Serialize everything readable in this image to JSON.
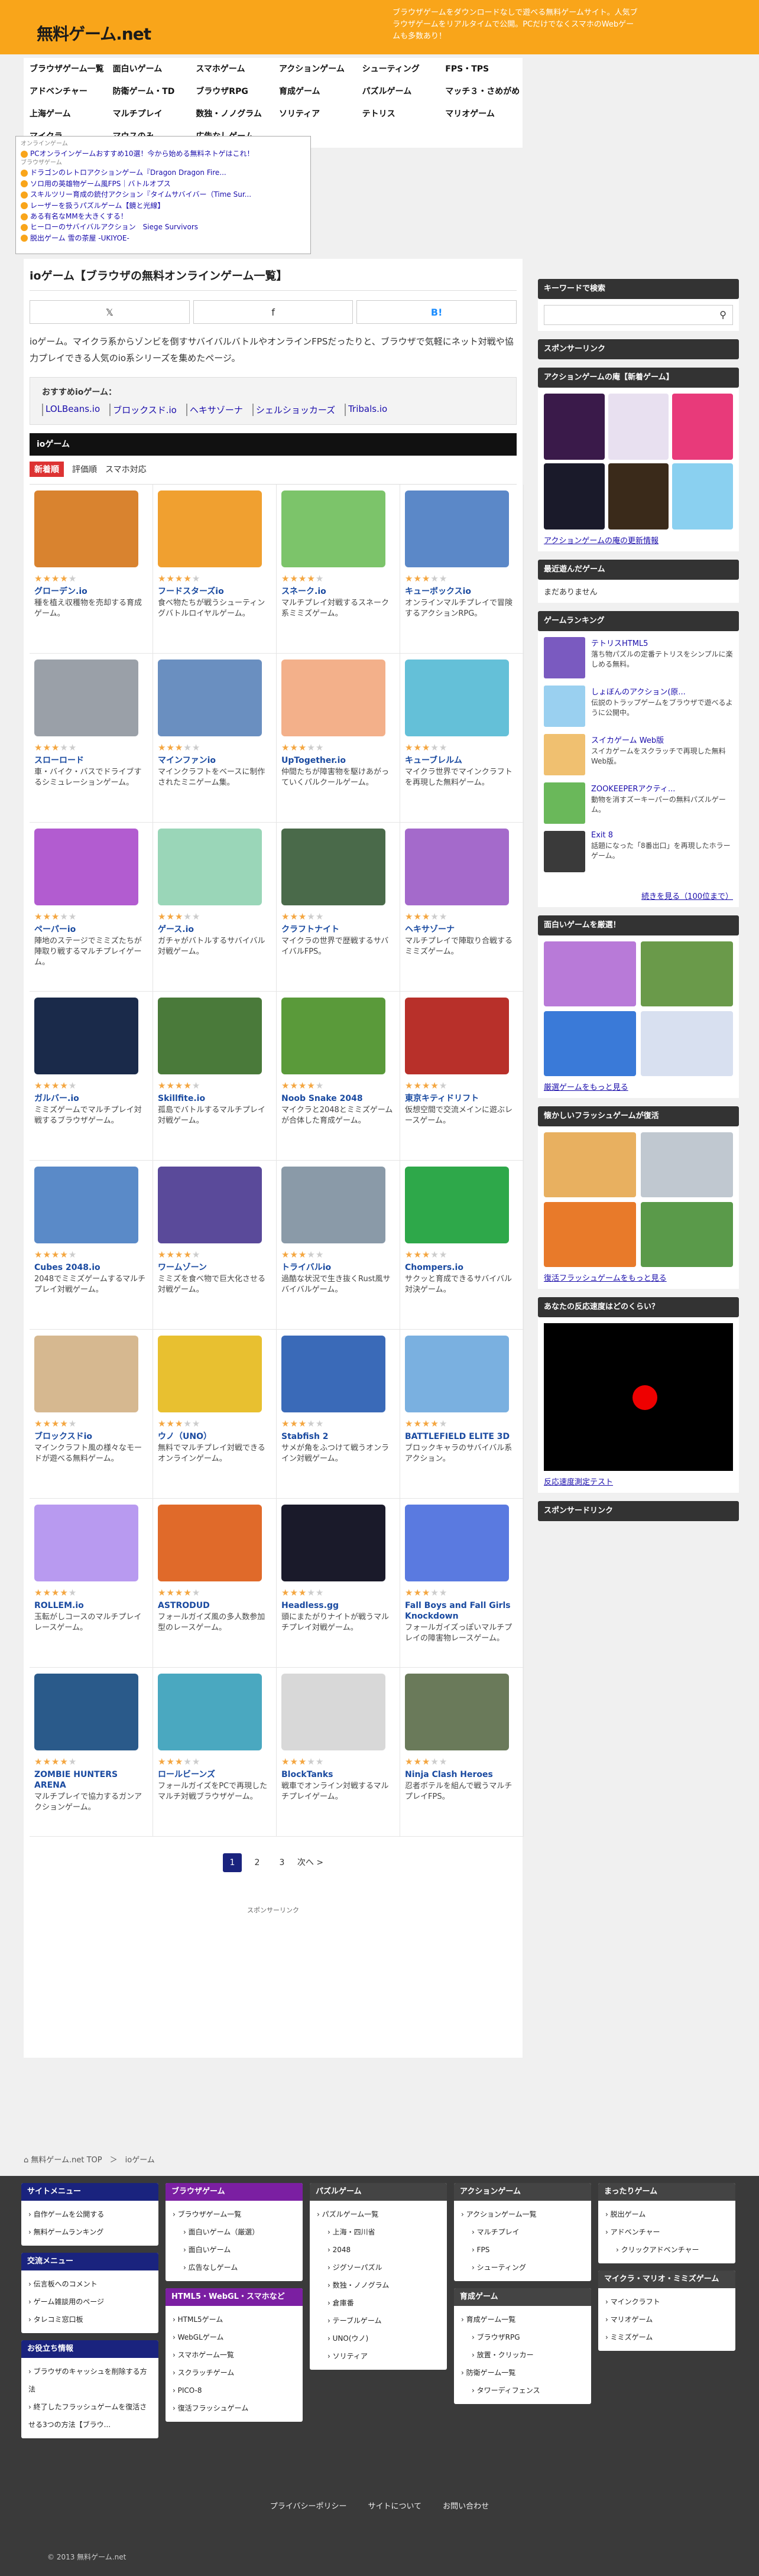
{
  "site": {
    "logo": "無料ゲーム.net",
    "tagline": "ブラウザゲームをダウンロードなしで遊べる無料ゲームサイト。人気ブラウザゲームをリアルタイムで公開。PCだけでなくスマホのWebゲームも多数あり！"
  },
  "nav": [
    "ブラウザゲーム一覧",
    "面白いゲーム",
    "スマホゲーム",
    "アクションゲーム",
    "シューティング",
    "FPS・TPS",
    "アドベンチャー",
    "防衛ゲーム・TD",
    "ブラウザRPG",
    "育成ゲーム",
    "パズルゲーム",
    "マッチ３・さめがめ",
    "上海ゲーム",
    "マルチプレイ",
    "数独・ノノグラム",
    "ソリティア",
    "テトリス",
    "マリオゲーム",
    "マイクラ",
    "マウスのみ",
    "広告なしゲーム"
  ],
  "news": {
    "header1": "オンラインゲーム",
    "header2": "ブラウザゲーム",
    "items": [
      "PCオンラインゲームおすすめ10選！今から始める無料ネトゲはこれ！",
      "ドラゴンのレトロアクションゲーム『Dragon Dragon Fire...",
      "ソロ用の英雄物ゲーム風FPS｜バトルオプス",
      "スキルツリー育成の銃付アクション『タイムサバイバー（Time Sur...",
      "レーザーを扱うパズルゲーム【鏡と光線】",
      "ある有名なMMを大きくする！",
      "ヒーローのサバイバルアクション　Siege Survivors",
      "脱出ゲーム 雪の茶屋 -UKIYOE-"
    ]
  },
  "main": {
    "title": "ioゲーム【ブラウザの無料オンラインゲーム一覧】",
    "share": [
      "𝕏",
      "f",
      "B!"
    ],
    "intro": "ioゲーム。マイクラ系からゾンビを倒すサバイバルバトルやオンラインFPSだったりと、ブラウザで気軽にネット対戦や協力プレイできる人気のio系シリーズを集めたページ。",
    "rec_label": "おすすめioゲーム：",
    "rec_links": [
      "LOLBeans.io",
      "ブロックスド.io",
      "ヘキサゾーナ",
      "シェルショッカーズ",
      "Tribals.io"
    ],
    "cat": "ioゲーム",
    "tabs": [
      "新着順",
      "評価順",
      "スマホ対応"
    ],
    "pages": [
      "1",
      "2",
      "3",
      "次へ >"
    ],
    "sponsor": "スポンサーリンク"
  },
  "games": [
    {
      "t": "グローデン.io",
      "d": "種を植え収穫物を売却する育成ゲーム。",
      "s": 4,
      "c": "#d9832f"
    },
    {
      "t": "フードスターズio",
      "d": "食べ物たちが戦うシューティングバトルロイヤルゲーム。",
      "s": 4,
      "c": "#f0a030"
    },
    {
      "t": "スネーク.io",
      "d": "マルチプレイ対戦するスネーク系ミミズゲーム。",
      "s": 4,
      "c": "#7cc46a"
    },
    {
      "t": "キューボックスio",
      "d": "オンラインマルチプレイで冒険するアクションRPG。",
      "s": 3,
      "c": "#5b88c8"
    },
    {
      "t": "スローロード",
      "d": "車・バイク・バスでドライブするシミュレーションゲーム。",
      "s": 3,
      "c": "#9aa0a8"
    },
    {
      "t": "マインファンio",
      "d": "マインクラフトをベースに制作されたミニゲーム集。",
      "s": 3,
      "c": "#6a8fc0"
    },
    {
      "t": "UpTogether.io",
      "d": "仲間たちが障害物を駆けあがっていくパルクールゲーム。",
      "s": 3,
      "c": "#f3b08a"
    },
    {
      "t": "キューブレルム",
      "d": "マイクラ世界でマインクラフトを再現した無料ゲーム。",
      "s": 3,
      "c": "#64c0d8"
    },
    {
      "t": "ペーパーio",
      "d": "陣地のステージでミミズたちが陣取り戦するマルチプレイゲーム。",
      "s": 3,
      "c": "#b25cd0"
    },
    {
      "t": "ゲース.io",
      "d": "ガチャがバトルするサバイバル対戦ゲーム。",
      "s": 3,
      "c": "#9ad6b8"
    },
    {
      "t": "クラフトナイト",
      "d": "マイクラの世界で歴戦するサバイバルFPS。",
      "s": 3,
      "c": "#4a6a4a"
    },
    {
      "t": "ヘキサゾーナ",
      "d": "マルチプレイで陣取り合戦するミミズゲーム。",
      "s": 3,
      "c": "#a46acb"
    },
    {
      "t": "ガルバー.io",
      "d": "ミミズゲームでマルチプレイ対戦するブラウザゲーム。",
      "s": 4,
      "c": "#1a2a4a"
    },
    {
      "t": "Skillfite.io",
      "d": "孤島でバトルするマルチプレイ対戦ゲーム。",
      "s": 4,
      "c": "#4a7a3a"
    },
    {
      "t": "Noob Snake 2048",
      "d": "マイクラと2048とミミズゲームが合体した育成ゲーム。",
      "s": 4,
      "c": "#5a9a3a"
    },
    {
      "t": "東京キティドリフト",
      "d": "仮想空間で交流メインに遊ぶレースゲーム。",
      "s": 4,
      "c": "#b8302a"
    },
    {
      "t": "Cubes 2048.io",
      "d": "2048でミミズゲームするマルチプレイ対戦ゲーム。",
      "s": 4,
      "c": "#5a8ac8"
    },
    {
      "t": "ワームゾーン",
      "d": "ミミズを食べ物で巨大化させる対戦ゲーム。",
      "s": 4,
      "c": "#5a4a9a"
    },
    {
      "t": "トライバルio",
      "d": "過酷な状況で生き抜くRust風サバイバルゲーム。",
      "s": 3,
      "c": "#8a9aa8"
    },
    {
      "t": "Chompers.io",
      "d": "サクッと育成できるサバイバル対決ゲーム。",
      "s": 3,
      "c": "#2ea84a"
    },
    {
      "t": "ブロックスドio",
      "d": "マインクラフト風の様々なモードが遊べる無料ゲーム。",
      "s": 4,
      "c": "#d6b890"
    },
    {
      "t": "ウノ（UNO）",
      "d": "無料でマルチプレイ対戦できるオンラインゲーム。",
      "s": 3,
      "c": "#e8c030"
    },
    {
      "t": "Stabfish 2",
      "d": "サメが角をふつけて戦うオンライン対戦ゲーム。",
      "s": 3,
      "c": "#3a6ab8"
    },
    {
      "t": "BATTLEFIELD ELITE 3D",
      "d": "ブロックキャラのサバイバル系アクション。",
      "s": 4,
      "c": "#7ab0e0"
    },
    {
      "t": "ROLLEM.io",
      "d": "玉転がしコースのマルチプレイレースゲーム。",
      "s": 4,
      "c": "#b89af0"
    },
    {
      "t": "ASTRODUD",
      "d": "フォールガイズ風の多人数参加型のレースゲーム。",
      "s": 4,
      "c": "#e06a2a"
    },
    {
      "t": "Headless.gg",
      "d": "頭にまたがりナイトが戦うマルチプレイ対戦ゲーム。",
      "s": 3,
      "c": "#1a1a2a"
    },
    {
      "t": "Fall Boys and Fall Girls Knockdown",
      "d": "フォールガイズっぽいマルチプレイの障害物レースゲーム。",
      "s": 3,
      "c": "#5a7ae0"
    },
    {
      "t": "ZOMBIE HUNTERS ARENA",
      "d": "マルチプレイで協力するガンアクションゲーム。",
      "s": 4,
      "c": "#2a5a8a"
    },
    {
      "t": "ロールビーンズ",
      "d": "フォールガイズをPCで再現したマルチ対戦ブラウザゲーム。",
      "s": 3,
      "c": "#4aa8c0"
    },
    {
      "t": "BlockTanks",
      "d": "戦車でオンライン対戦するマルチプレイゲーム。",
      "s": 3,
      "c": "#d8d8d8"
    },
    {
      "t": "Ninja Clash Heroes",
      "d": "忍者ボテルを組んで戦うマルチプレイFPS。",
      "s": 3,
      "c": "#6a7a5a"
    }
  ],
  "side": {
    "search_h": "キーワードで検索",
    "sponsor_h": "スポンサーリンク",
    "arcade_h": "アクションゲームの庵【新着ゲーム】",
    "arcade_link": "アクションゲームの庵の更新情報",
    "recent_h": "最近遊んだゲーム",
    "recent_txt": "まだありません",
    "rank_h": "ゲームランキング",
    "ranks": [
      {
        "t": "テトリスHTML5",
        "d": "落ち物パズルの定番テトリスをシンプルに楽しめる無料。",
        "c": "#7a5ac0"
      },
      {
        "t": "しょぼんのアクション(原...",
        "d": "伝説のトラップゲームをブラウザで遊べるように公開中。",
        "c": "#9ad0f0"
      },
      {
        "t": "スイカゲーム Web版",
        "d": "スイカゲームをスクラッチで再現した無料Web版。",
        "c": "#f0c070"
      },
      {
        "t": "ZOOKEEPERアクティ...",
        "d": "動物を消すズーキーパーの無料パズルゲーム。",
        "c": "#6ab85a"
      },
      {
        "t": "Exit 8",
        "d": "話題になった「8番出口」を再現したホラーゲーム。",
        "c": "#3a3a3a"
      }
    ],
    "rank_more": "続きを見る（100位まで）",
    "fun_h": "面白いゲームを厳選！",
    "fun_link": "厳選ゲームをもっと見る",
    "flash_h": "懐かしいフラッシュゲームが復活",
    "flash_link": "復活フラッシュゲームをもっと見る",
    "react_h": "あなたの反応速度はどのくらい？",
    "react_link": "反応速度測定テスト",
    "sponsor2_h": "スポンサードリンク"
  },
  "crumb": "無料ゲーム.net TOP　＞　ioゲーム",
  "footer": {
    "cols": [
      [
        {
          "h": "サイトメニュー",
          "c": "#1a237e",
          "items": [
            "自作ゲームを公開する",
            "無料ゲームランキング"
          ]
        },
        {
          "h": "交流メニュー",
          "c": "#1a237e",
          "items": [
            "伝言板へのコメント",
            "ゲーム雑談用のページ",
            "タレコミ窓口板"
          ]
        },
        {
          "h": "お役立ち情報",
          "c": "#1a237e",
          "items": [
            "ブラウザのキャッシュを削除する方法",
            "終了したフラッシュゲームを復活させる3つの方法【ブラウ..."
          ]
        }
      ],
      [
        {
          "h": "ブラウザゲーム",
          "c": "#7b1fa2",
          "items": [
            "ブラウザゲーム一覧",
            "面白いゲーム（厳選）",
            "面白いゲーム",
            "広告なしゲーム"
          ],
          "sub": [
            1,
            2,
            3
          ]
        },
        {
          "h": "HTML5・WebGL・スマホなど",
          "c": "#7b1fa2",
          "items": [
            "HTML5ゲーム",
            "WebGLゲーム",
            "スマホゲーム一覧",
            "スクラッチゲーム",
            "PICO-8",
            "復活フラッシュゲーム"
          ]
        }
      ],
      [
        {
          "h": "パズルゲーム",
          "c": "#444",
          "items": [
            "パズルゲーム一覧",
            "上海・四川省",
            "2048",
            "ジグソーパズル",
            "数独・ノノグラム",
            "倉庫番",
            "テーブルゲーム",
            "UNO(ウノ)",
            "ソリティア"
          ],
          "sub": [
            1,
            2,
            3,
            4,
            5,
            6,
            7,
            8
          ]
        }
      ],
      [
        {
          "h": "アクションゲーム",
          "c": "#444",
          "items": [
            "アクションゲーム一覧",
            "マルチプレイ",
            "FPS",
            "シューティング"
          ],
          "sub": [
            1,
            2,
            3
          ]
        },
        {
          "h": "育成ゲーム",
          "c": "#444",
          "items": [
            "育成ゲーム一覧",
            "ブラウザRPG",
            "放置・クリッカー",
            "防衛ゲーム一覧",
            "タワーディフェンス"
          ],
          "sub": [
            1,
            2,
            4
          ]
        }
      ],
      [
        {
          "h": "まったりゲーム",
          "c": "#444",
          "items": [
            "脱出ゲーム",
            "アドベンチャー",
            "クリックアドベンチャー"
          ],
          "sub": [
            2
          ]
        },
        {
          "h": "マイクラ・マリオ・ミミズゲーム",
          "c": "#444",
          "items": [
            "マインクラフト",
            "マリオゲーム",
            "ミミズゲーム"
          ]
        }
      ]
    ],
    "links": [
      "プライバシーポリシー",
      "サイトについて",
      "お問い合わせ"
    ],
    "copy": "© 2013 無料ゲーム.net"
  }
}
